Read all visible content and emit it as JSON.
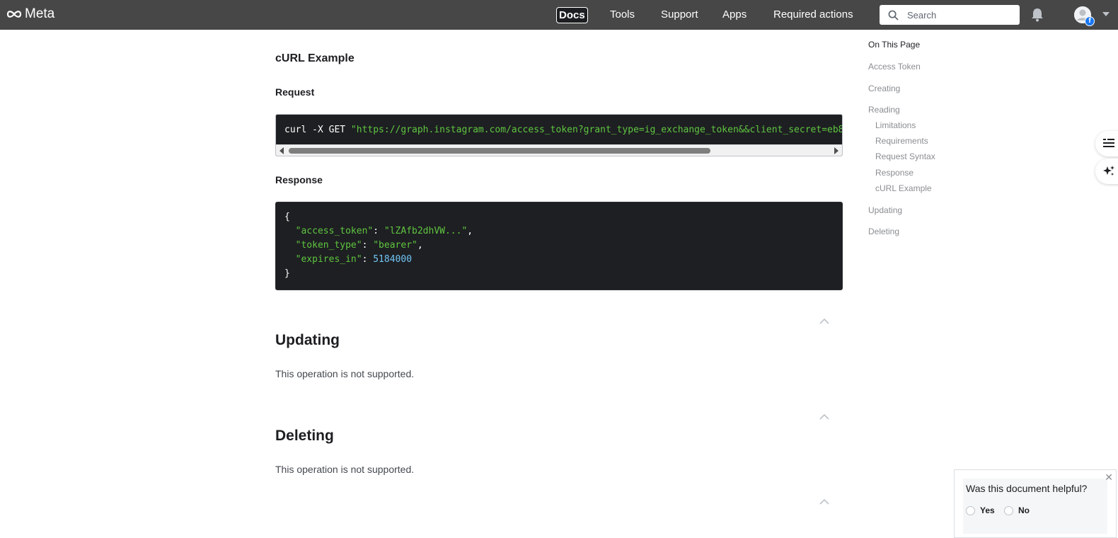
{
  "header": {
    "logo_text": "Meta",
    "nav": [
      {
        "label": "Docs",
        "active": true
      },
      {
        "label": "Tools"
      },
      {
        "label": "Support"
      },
      {
        "label": "Apps"
      },
      {
        "label": "Required actions"
      }
    ],
    "search_placeholder": "Search"
  },
  "content": {
    "curl_title": "cURL Example",
    "request_label": "Request",
    "request_cmd": "curl -X GET ",
    "request_url": "\"https://graph.instagram.com/access_token?grant_type=ig_exchange_token&&client_secret=eb8",
    "response_label": "Response",
    "response": {
      "open": "{",
      "access_token_key": "\"access_token\"",
      "access_token_val": "\"lZAfb2dhVW...\"",
      "token_type_key": "\"token_type\"",
      "token_type_val": "\"bearer\"",
      "expires_in_key": "\"expires_in\"",
      "expires_in_val": "5184000",
      "close": "}"
    },
    "updating_title": "Updating",
    "updating_text": "This operation is not supported.",
    "deleting_title": "Deleting",
    "deleting_text": "This operation is not supported."
  },
  "toc": {
    "title": "On This Page",
    "items": [
      {
        "label": "Access Token",
        "level": 1
      },
      {
        "label": "Creating",
        "level": 1
      },
      {
        "label": "Reading",
        "level": 1
      },
      {
        "label": "Limitations",
        "level": 2
      },
      {
        "label": "Requirements",
        "level": 2
      },
      {
        "label": "Request Syntax",
        "level": 2
      },
      {
        "label": "Response",
        "level": 2
      },
      {
        "label": "cURL Example",
        "level": 2
      },
      {
        "label": "Updating",
        "level": 1
      },
      {
        "label": "Deleting",
        "level": 1
      }
    ]
  },
  "feedback": {
    "question": "Was this document helpful?",
    "yes": "Yes",
    "no": "No"
  },
  "colors": {
    "topbar": "#474747",
    "code_bg": "#1e1f22",
    "code_string": "#5ec640",
    "code_number": "#71c6f7"
  }
}
